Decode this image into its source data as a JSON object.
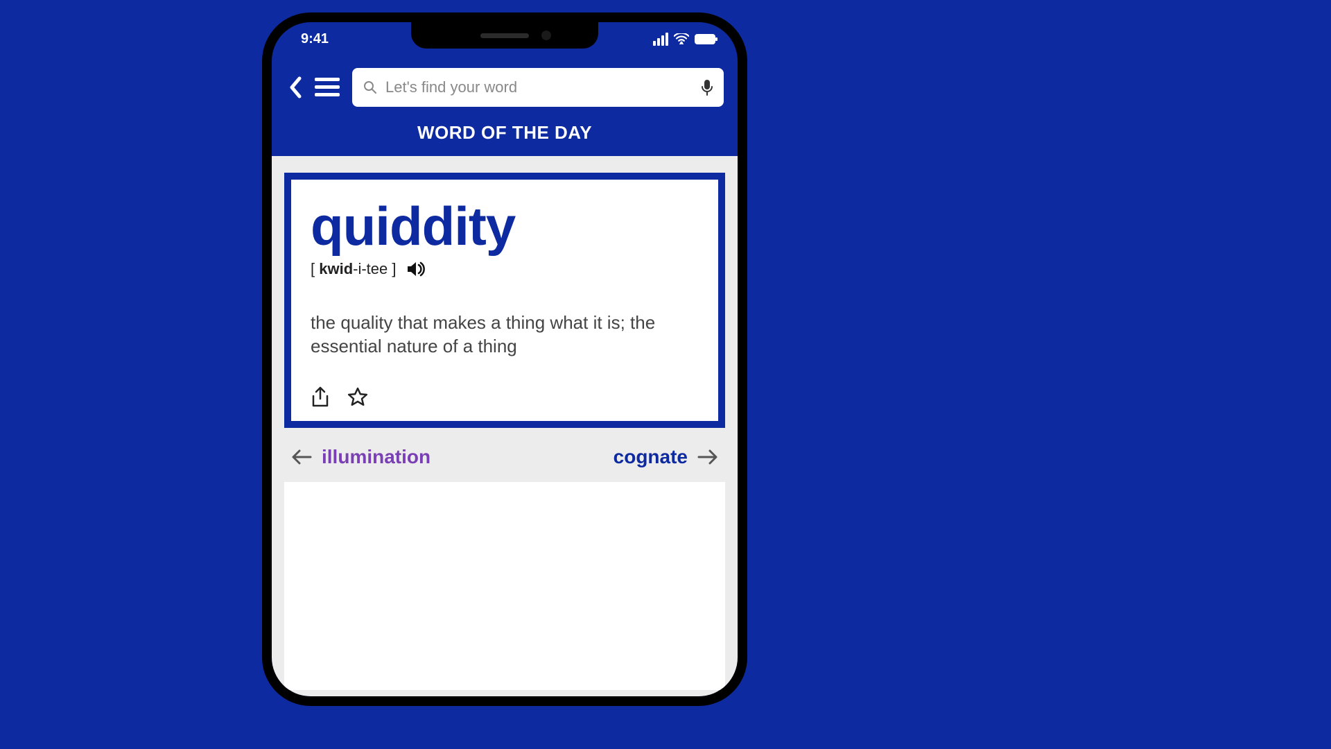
{
  "status": {
    "time": "9:41"
  },
  "search": {
    "placeholder": "Let's find your word"
  },
  "section_title": "WORD OF THE DAY",
  "word": {
    "headword": "quiddity",
    "pronunciation_prefix": "[ ",
    "pronunciation_bold": "kwid",
    "pronunciation_rest": "-i-tee ]",
    "definition": "the quality that makes a thing what it is; the essential nature of a thing"
  },
  "nav": {
    "prev": "illumination",
    "next": "cognate"
  }
}
